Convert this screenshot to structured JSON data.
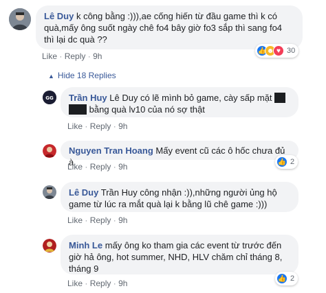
{
  "comments": [
    {
      "author": "Lê Duy",
      "text": "k công bằng :))),ae cống hiến từ đầu game thì k có quà,mấy ông suốt ngày chê fo4 bây giờ fo3 sắp thì sang fo4 thì lại dc quà ??",
      "like": "Like",
      "reply": "Reply",
      "time": "9h",
      "reactions_count": "30",
      "reaction_icons": [
        "like-icon",
        "haha-icon",
        "love-icon"
      ]
    }
  ],
  "hide_replies": "Hide 18 Replies",
  "replies": [
    {
      "author": "Trần Huy",
      "text_1": "Lê Duy có lẽ mình bỏ game, cày sấp mặt",
      "text_2": "bằng quà lv10 của nó sợ thật",
      "like": "Like",
      "reply": "Reply",
      "time": "9h"
    },
    {
      "author": "Nguyen Tran Hoang",
      "text": "Mấy event cũ các ô hốc chưa đủ à",
      "like": "Like",
      "reply": "Reply",
      "time": "9h",
      "reactions_count": "2"
    },
    {
      "author": "Lê Duy",
      "text": "Trần Huy công nhận :)),những người ủng hộ game từ lúc ra mắt quà lại k bằng lũ chê game :)))",
      "like": "Like",
      "reply": "Reply",
      "time": "9h"
    },
    {
      "author": "Minh Le",
      "text": "mấy ông ko tham gia các event từ trước đến giờ hả ông, hot summer, NHD, HLV chăm chỉ tháng 8, tháng 9",
      "like": "Like",
      "reply": "Reply",
      "time": "9h",
      "reactions_count": "2"
    }
  ],
  "colors": {
    "link": "#385898",
    "bubble": "#f2f3f5",
    "like_blue": "#1877f2"
  }
}
